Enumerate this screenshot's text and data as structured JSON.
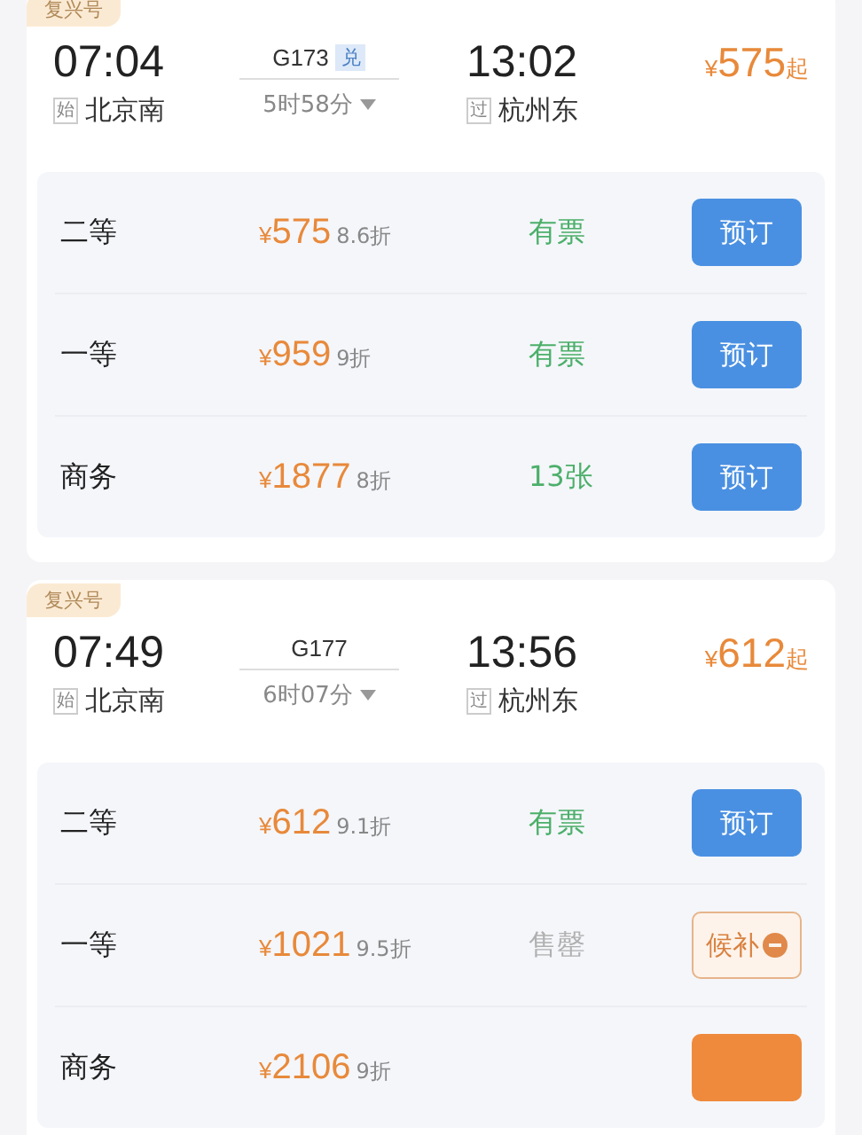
{
  "trains": [
    {
      "badge": "复兴号",
      "depart_time": "07:04",
      "train_no": "G173",
      "exchange_tag": "兑",
      "duration": "5时58分",
      "arrive_time": "13:02",
      "from_tag": "始",
      "from_station": "北京南",
      "to_tag": "过",
      "to_station": "杭州东",
      "price_symbol": "¥",
      "price": "575",
      "price_suffix": "起",
      "seats": [
        {
          "name": "二等",
          "symbol": "¥",
          "price": "575",
          "discount": "8.6折",
          "status": "有票",
          "kind": "available",
          "button": {
            "kind": "book",
            "label": "预订"
          }
        },
        {
          "name": "一等",
          "symbol": "¥",
          "price": "959",
          "discount": "9折",
          "status": "有票",
          "kind": "available",
          "button": {
            "kind": "book",
            "label": "预订"
          }
        },
        {
          "name": "商务",
          "symbol": "¥",
          "price": "1877",
          "discount": "8折",
          "status": "13张",
          "kind": "available",
          "button": {
            "kind": "book",
            "label": "预订"
          }
        }
      ]
    },
    {
      "badge": "复兴号",
      "depart_time": "07:49",
      "train_no": "G177",
      "duration": "6时07分",
      "arrive_time": "13:56",
      "from_tag": "始",
      "from_station": "北京南",
      "to_tag": "过",
      "to_station": "杭州东",
      "price_symbol": "¥",
      "price": "612",
      "price_suffix": "起",
      "seats": [
        {
          "name": "二等",
          "symbol": "¥",
          "price": "612",
          "discount": "9.1折",
          "status": "有票",
          "kind": "available",
          "button": {
            "kind": "book",
            "label": "预订"
          }
        },
        {
          "name": "一等",
          "symbol": "¥",
          "price": "1021",
          "discount": "9.5折",
          "status": "售罄",
          "kind": "soldout",
          "button": {
            "kind": "waitlist",
            "label": "候补"
          }
        },
        {
          "name": "商务",
          "symbol": "¥",
          "price": "2106",
          "discount": "9折",
          "button": {
            "kind": "waitlist-filled"
          }
        }
      ]
    }
  ]
}
